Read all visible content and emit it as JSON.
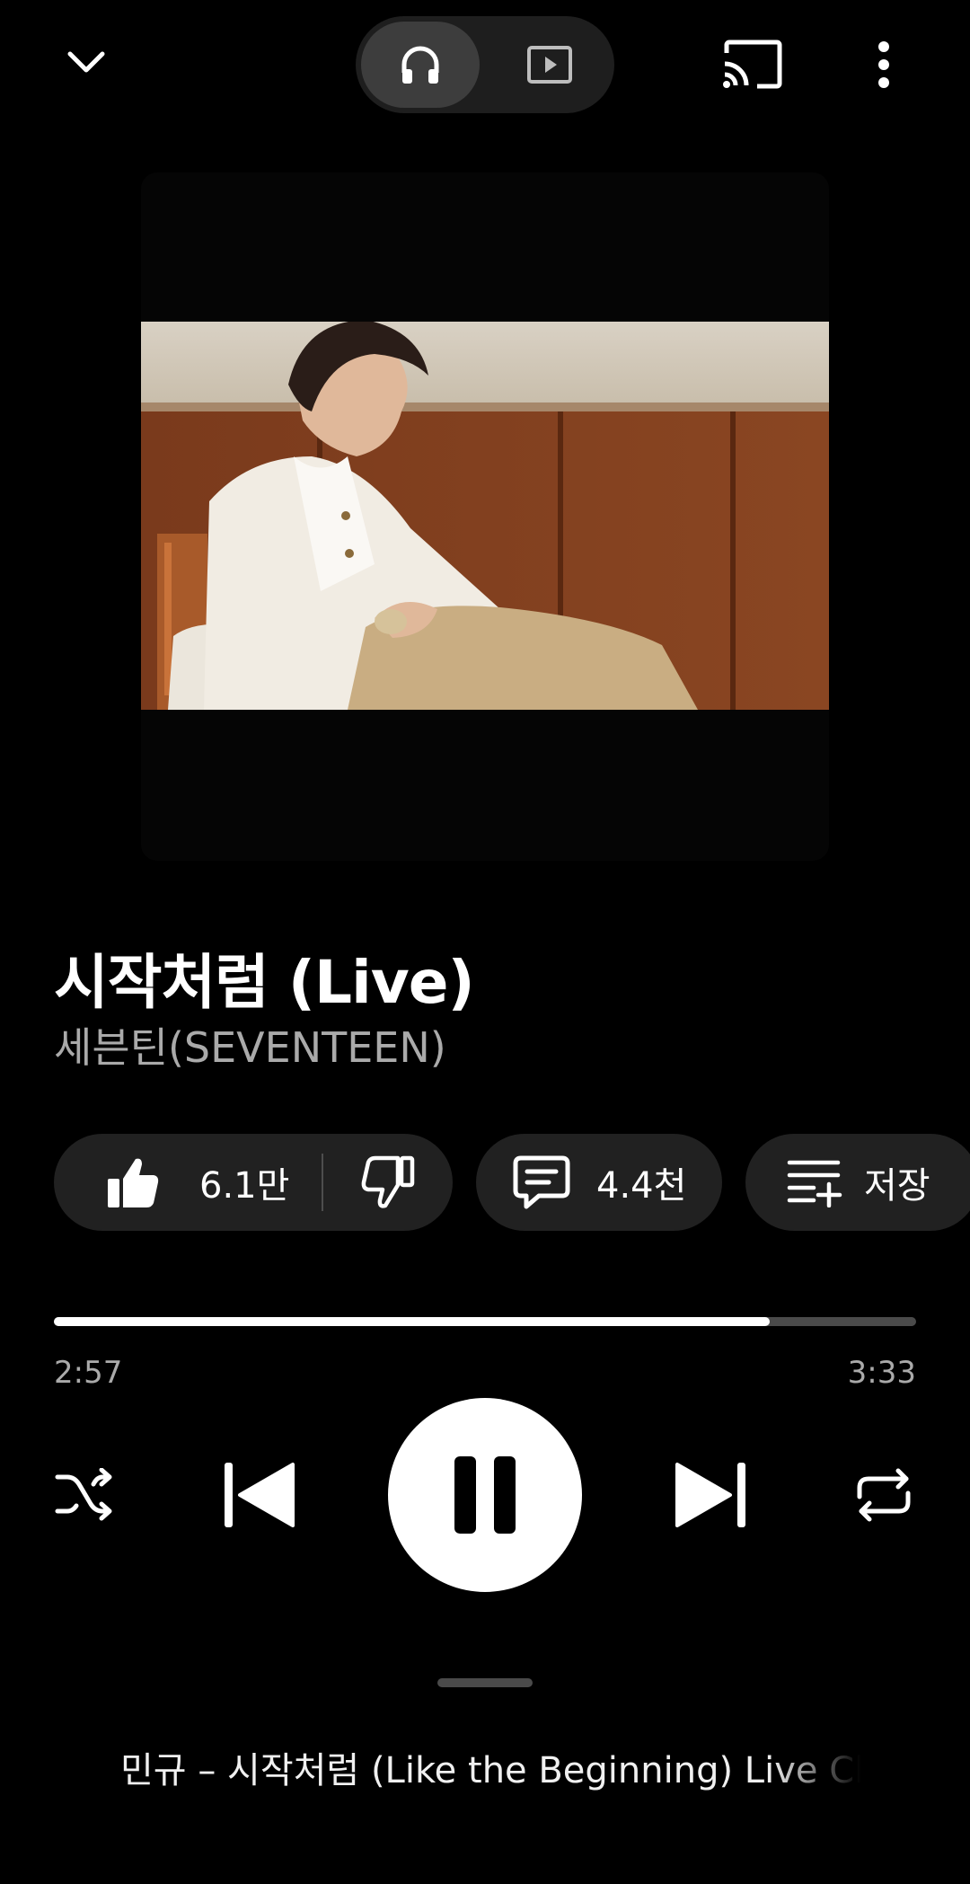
{
  "header": {
    "collapse_icon": "chevron-down-icon",
    "mode_audio_icon": "headphones-icon",
    "mode_video_icon": "video-icon",
    "cast_icon": "cast-icon",
    "more_icon": "more-vert-icon"
  },
  "song": {
    "title": "시작처럼 (Live)",
    "artist": "세븐틴(SEVENTEEN)"
  },
  "actions": {
    "like_count": "6.1만",
    "comment_count": "4.4천",
    "save_label": "저장"
  },
  "player": {
    "elapsed": "2:57",
    "duration": "3:33",
    "progress_fraction": 0.83
  },
  "up_next": {
    "text": "민규 – 시작처럼 (Like the Beginning) Live Clip"
  },
  "colors": {
    "background": "#000000",
    "pill": "#212121",
    "progress_track": "#4a4a4a",
    "progress_fill": "#ffffff",
    "secondary_text": "#aaaaaa"
  }
}
